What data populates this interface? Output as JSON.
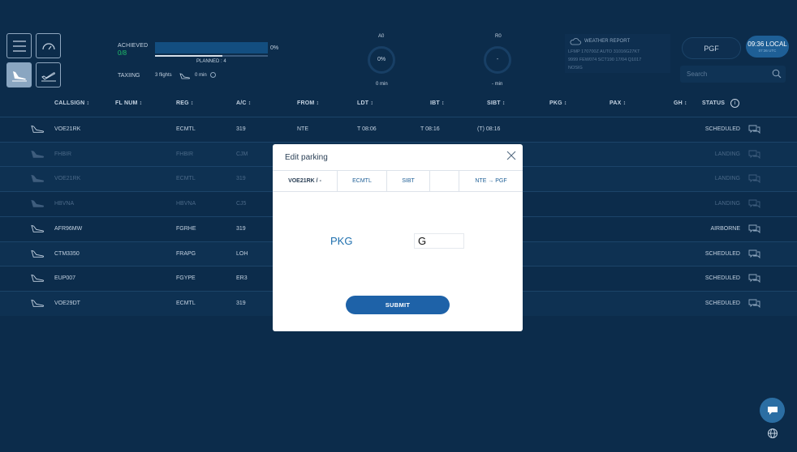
{
  "toolbar": {
    "achieved_label": "ACHIEVED",
    "achieved_value": "0/8",
    "progress_percent": "0%",
    "progress_fraction": 0.0,
    "planned_fraction": 0.6,
    "planned_label": "PLANNED : 4",
    "taxiing_label": "TAXIING",
    "taxiing_flights": "3 flights",
    "taxiing_min": "0 min",
    "gauge_a0": {
      "label": "A0",
      "value": "0%",
      "sub": "0 min"
    },
    "gauge_r0": {
      "label": "R0",
      "value": "-",
      "sub": "- min"
    },
    "weather": {
      "title": "WEATHER REPORT",
      "line1": "LFMP 170700Z AUTO 31016G27KT",
      "line2": "9999 FEW074 SCT190 17/04 Q1017",
      "line3": "NOSIG"
    },
    "airport": "PGF",
    "time_local": "09:36 LOCAL",
    "time_utc": "07:36 UTC",
    "search_placeholder": "Search"
  },
  "table": {
    "columns": {
      "callsign": "CALLSIGN ↕",
      "flnum": "FL NUM ↕",
      "reg": "REG ↕",
      "ac": "A/C ↕",
      "from": "FROM ↕",
      "ldt": "LDT ↕",
      "ibt": "IBT ↕",
      "sibt": "SIBT ↕",
      "pkg": "PKG ↕",
      "pax": "PAX ↕",
      "gh": "GH ↕",
      "status": "STATUS"
    },
    "rows": [
      {
        "callsign": "VOE21RK",
        "reg": "ECMTL",
        "ac": "319",
        "from": "NTE",
        "ldt": "T 08:06",
        "ibt": "T 08:16",
        "sibt": "(T) 08:16",
        "status": "SCHEDULED"
      },
      {
        "callsign": "FHBIR",
        "reg": "FHBIR",
        "ac": "CJM",
        "status": "LANDING"
      },
      {
        "callsign": "VOE21RK",
        "reg": "ECMTL",
        "ac": "319",
        "status": "LANDING"
      },
      {
        "callsign": "HBVNA",
        "reg": "HBVNA",
        "ac": "CJ5",
        "status": "LANDING"
      },
      {
        "callsign": "AFR96MW",
        "reg": "FGRHE",
        "ac": "319",
        "status": "AIRBORNE"
      },
      {
        "callsign": "CTM3350",
        "reg": "FRAPG",
        "ac": "LOH",
        "status": "SCHEDULED"
      },
      {
        "callsign": "EUP007",
        "reg": "FGYPE",
        "ac": "ER3",
        "status": "SCHEDULED"
      },
      {
        "callsign": "VOE29DT",
        "reg": "ECMTL",
        "ac": "319",
        "status": "SCHEDULED"
      }
    ]
  },
  "modal": {
    "title": "Edit parking",
    "tabs": [
      "VOE21RK / -",
      "ECMTL",
      "SIBT",
      "",
      "NTE → PGF"
    ],
    "field_label": "PKG",
    "field_value": "G",
    "submit_label": "SUBMIT"
  },
  "colors": {
    "background": "#0c2c4b",
    "accent": "#1e62a8",
    "achieved": "#1fbf6a"
  }
}
